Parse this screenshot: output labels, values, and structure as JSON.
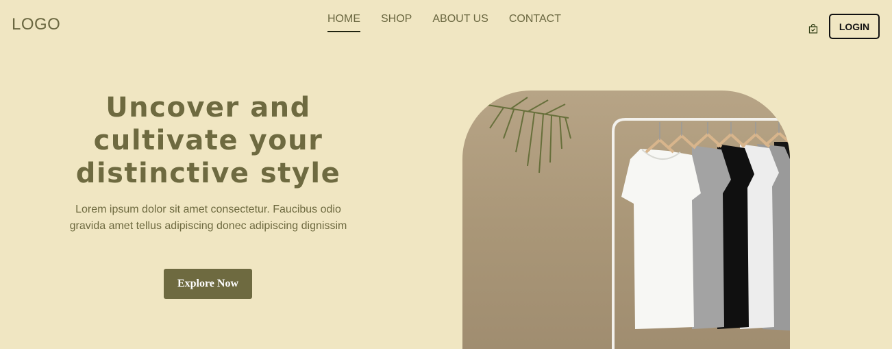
{
  "header": {
    "logo": "LOGO",
    "nav": [
      {
        "label": "HOME",
        "active": true
      },
      {
        "label": "SHOP",
        "active": false
      },
      {
        "label": "ABOUT US",
        "active": false
      },
      {
        "label": "CONTACT",
        "active": false
      }
    ],
    "cart_icon": "shopping-bag-icon",
    "login_label": "LOGIN"
  },
  "hero": {
    "title": "Uncover and cultivate your distinctive style",
    "description": "Lorem ipsum dolor sit amet consectetur. Faucibus odio gravida amet tellus adipiscing donec adipiscing dignissim",
    "cta_label": "Explore Now",
    "image": "t-shirts-on-clothing-rack-photo"
  },
  "colors": {
    "background": "#f0e6c2",
    "accent": "#6e6a40",
    "nav_underline": "#1f2310"
  }
}
